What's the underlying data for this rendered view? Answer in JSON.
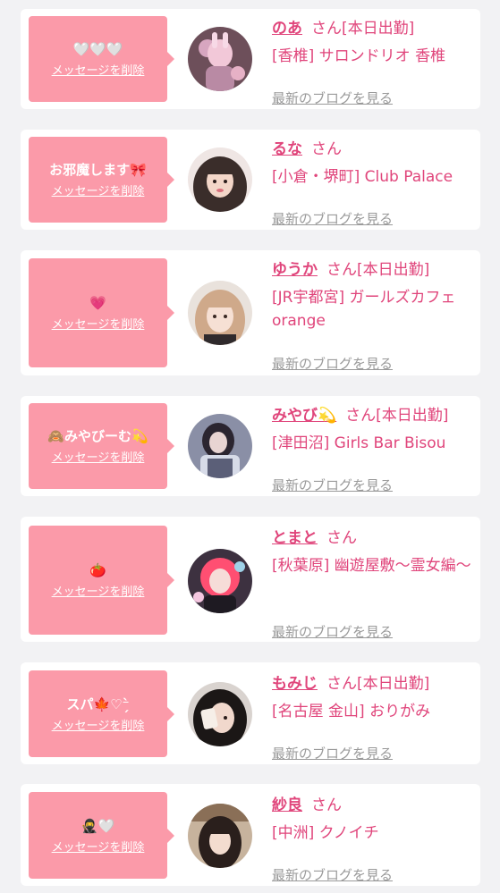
{
  "delete_label": "メッセージを削除",
  "san_label": "さん",
  "blog_label": "最新のブログを見る",
  "colors": {
    "bubble": "#fb9aa9",
    "accent": "#e0457b",
    "muted": "#9a9a9a"
  },
  "entries": [
    {
      "message": "🤍🤍🤍",
      "name": "のあ",
      "status": "[本日出勤]",
      "shop": "[香椎] サロンドリオ 香椎"
    },
    {
      "message": "お邪魔します🎀",
      "name": "るな",
      "status": "",
      "shop": "[小倉・堺町] Club Palace"
    },
    {
      "message": "💗",
      "name": "ゆうか",
      "status": "[本日出勤]",
      "shop": "[JR宇都宮] ガールズカフェ orange"
    },
    {
      "message": "🙈みやびーむ💫",
      "name": "みやび💫",
      "status": "[本日出勤]",
      "shop": "[津田沼] Girls Bar Bisou"
    },
    {
      "message": "🍅",
      "name": "とまと",
      "status": "",
      "shop": "[秋葉原] 幽遊屋敷〜霊女編〜"
    },
    {
      "message": "スパ🍁♡⁻̗̀",
      "name": "もみじ",
      "status": "[本日出勤]",
      "shop": "[名古屋 金山] おりがみ"
    },
    {
      "message": "🥷🤍",
      "name": "紗良",
      "status": "",
      "shop": "[中洲] クノイチ"
    }
  ]
}
